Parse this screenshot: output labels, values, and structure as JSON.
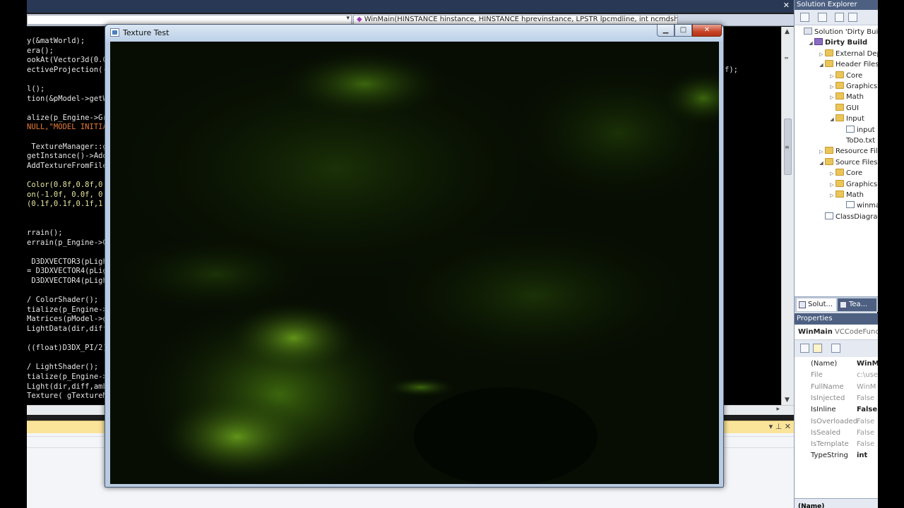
{
  "editor": {
    "navbar": {
      "method": "WinMain(HINSTANCE hinstance, HINSTANCE hprevinstance, LPSTR lpcmdline, int ncmdshow)"
    },
    "lines": [
      {
        "text": "y(&matWorld);"
      },
      {
        "text": "era();"
      },
      {
        "text": "ookAt(Vector3d(0.0f"
      },
      {
        "text": "ectiveProjection((f",
        "tail": "f);"
      },
      {
        "text": ""
      },
      {
        "text": "l();"
      },
      {
        "text": "tion(&pModel->getWo"
      },
      {
        "text": ""
      },
      {
        "text": "alize(p_Engine->Gra"
      },
      {
        "text": "NULL,\"MODEL INITIAL"
      },
      {
        "text": ""
      },
      {
        "text": " TextureManager::ge"
      },
      {
        "text": "getInstance()->AddT"
      },
      {
        "text": "AddTextureFromFile("
      },
      {
        "text": ""
      },
      {
        "text": "Color(0.8f,0.8f,0.8"
      },
      {
        "text": "on(-1.0f, 0.0f, 0.0"
      },
      {
        "text": "(0.1f,0.1f,0.1f,1.0"
      },
      {
        "text": ""
      },
      {
        "text": ""
      },
      {
        "text": "rrain();"
      },
      {
        "text": "errain(p_Engine->Gr"
      },
      {
        "text": ""
      },
      {
        "text": " D3DXVECTOR3(pLight"
      },
      {
        "text": "= D3DXVECTOR4(pLigh"
      },
      {
        "text": " D3DXVECTOR4(pLight"
      },
      {
        "text": ""
      },
      {
        "text": "/ ColorShader();"
      },
      {
        "text": "tialize(p_Engine->G"
      },
      {
        "text": "Matrices(pModel->ge"
      },
      {
        "text": "LightData(dir,diff,"
      },
      {
        "text": ""
      },
      {
        "text": "((float)D3DX_PI/2);"
      },
      {
        "text": ""
      },
      {
        "text": "/ LightShader();"
      },
      {
        "text": "tialize(p_Engine->G"
      },
      {
        "text": "Light(dir,diff,amb)"
      },
      {
        "text": "Texture( gTextureMa"
      }
    ]
  },
  "solution_explorer": {
    "title": "Solution Explorer",
    "items": [
      {
        "label": "Solution 'Dirty Build",
        "level": 0,
        "icon": "solution-icon",
        "twisty": ""
      },
      {
        "label": "Dirty Build",
        "level": 1,
        "icon": "project-icon",
        "twisty": "◢",
        "bold": true
      },
      {
        "label": "External Dep",
        "level": 2,
        "icon": "folder-icon",
        "twisty": "▷"
      },
      {
        "label": "Header Files",
        "level": 2,
        "icon": "folder-icon",
        "twisty": "◢"
      },
      {
        "label": "Core",
        "level": 3,
        "icon": "folder-icon",
        "twisty": "▷"
      },
      {
        "label": "Graphics",
        "level": 3,
        "icon": "folder-icon",
        "twisty": "▷"
      },
      {
        "label": "Math",
        "level": 3,
        "icon": "folder-icon",
        "twisty": "▷"
      },
      {
        "label": "GUI",
        "level": 3,
        "icon": "folder-icon",
        "twisty": ""
      },
      {
        "label": "Input",
        "level": 3,
        "icon": "folder-icon",
        "twisty": "◢"
      },
      {
        "label": "input",
        "level": 4,
        "icon": "file-icon",
        "twisty": ""
      },
      {
        "label": "ToDo.txt",
        "level": 4,
        "icon": "",
        "twisty": ""
      },
      {
        "label": "Resource File",
        "level": 2,
        "icon": "folder-icon",
        "twisty": "▷"
      },
      {
        "label": "Source Files",
        "level": 2,
        "icon": "folder-icon",
        "twisty": "◢"
      },
      {
        "label": "Core",
        "level": 3,
        "icon": "folder-icon",
        "twisty": "▷"
      },
      {
        "label": "Graphics",
        "level": 3,
        "icon": "folder-icon",
        "twisty": "▷"
      },
      {
        "label": "Math",
        "level": 3,
        "icon": "folder-icon",
        "twisty": "▷"
      },
      {
        "label": "winmain",
        "level": 4,
        "icon": "file-icon",
        "twisty": ""
      },
      {
        "label": "ClassDiagram",
        "level": 2,
        "icon": "diagram-icon",
        "twisty": ""
      }
    ],
    "tabs": [
      {
        "label": "Solut..."
      },
      {
        "label": "Tea..."
      }
    ]
  },
  "properties": {
    "title": "Properties",
    "object_name": "WinMain",
    "object_type": "VCCodeFunctio",
    "rows": [
      {
        "key": "(Name)",
        "value": "WinM",
        "enabled": true
      },
      {
        "key": "File",
        "value": "c:\\use",
        "enabled": false
      },
      {
        "key": "FullName",
        "value": "WinM",
        "enabled": false
      },
      {
        "key": "IsInjected",
        "value": "False",
        "enabled": false
      },
      {
        "key": "IsInline",
        "value": "False",
        "enabled": true
      },
      {
        "key": "IsOverloaded",
        "value": "False",
        "enabled": false
      },
      {
        "key": "IsSealed",
        "value": "False",
        "enabled": false
      },
      {
        "key": "IsTemplate",
        "value": "False",
        "enabled": false
      },
      {
        "key": "TypeString",
        "value": "int",
        "enabled": true
      }
    ],
    "footer": "(Name)"
  },
  "app_window": {
    "title": "Texture Test",
    "min": "▁",
    "max": "□",
    "close": "✕"
  }
}
